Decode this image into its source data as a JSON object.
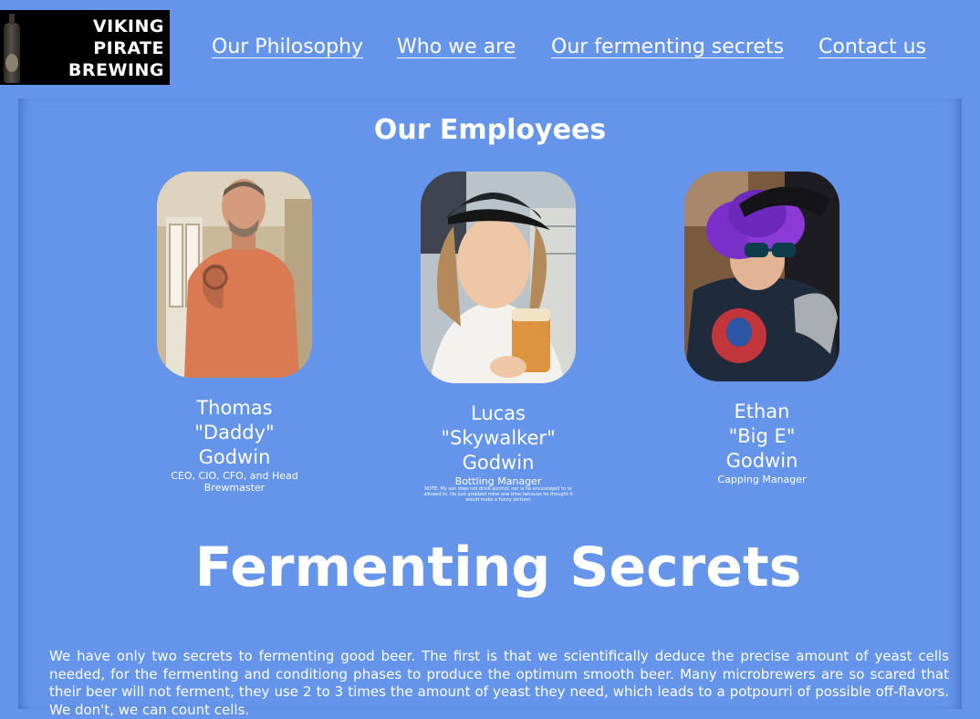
{
  "header": {
    "logo": {
      "line1": "VIKING",
      "line2": "PIRATE",
      "line3": "BREWING"
    },
    "nav": [
      {
        "label": "Our Philosophy"
      },
      {
        "label": "Who we are"
      },
      {
        "label": "Our fermenting secrets"
      },
      {
        "label": "Contact us"
      }
    ]
  },
  "employees_section": {
    "title": "Our Employees",
    "employees": [
      {
        "first": "Thomas",
        "nickname": "\"Daddy\"",
        "last": "Godwin",
        "role": "CEO, CIO, CFO, and Head Brewmaster",
        "note": ""
      },
      {
        "first": "Lucas",
        "nickname": "\"Skywalker\"",
        "last": "Godwin",
        "role": "Bottling Manager",
        "note": "NOTE: My son does not drink alcohol, nor is he encouraged to or allowed to. He just grabbed mine one time because he thought it would make a funny picture!"
      },
      {
        "first": "Ethan",
        "nickname": "\"Big E\"",
        "last": "Godwin",
        "role": "Capping Manager",
        "note": ""
      }
    ]
  },
  "secrets_section": {
    "title": "Fermenting Secrets",
    "body": "We have only two secrets to fermenting good beer. The first is that we scientifically deduce the precise amount of yeast cells needed, for the fermenting and conditiong phases to produce the optimum smooth beer. Many microbrewers are so scared that their beer will not ferment, they use 2 to 3 times the amount of yeast they need, which leads to a potpourri of possible off-flavors. We don't, we can count cells."
  },
  "colors": {
    "page_bg": "#6495ea",
    "text": "#ffffff",
    "logo_bg": "#000000"
  }
}
